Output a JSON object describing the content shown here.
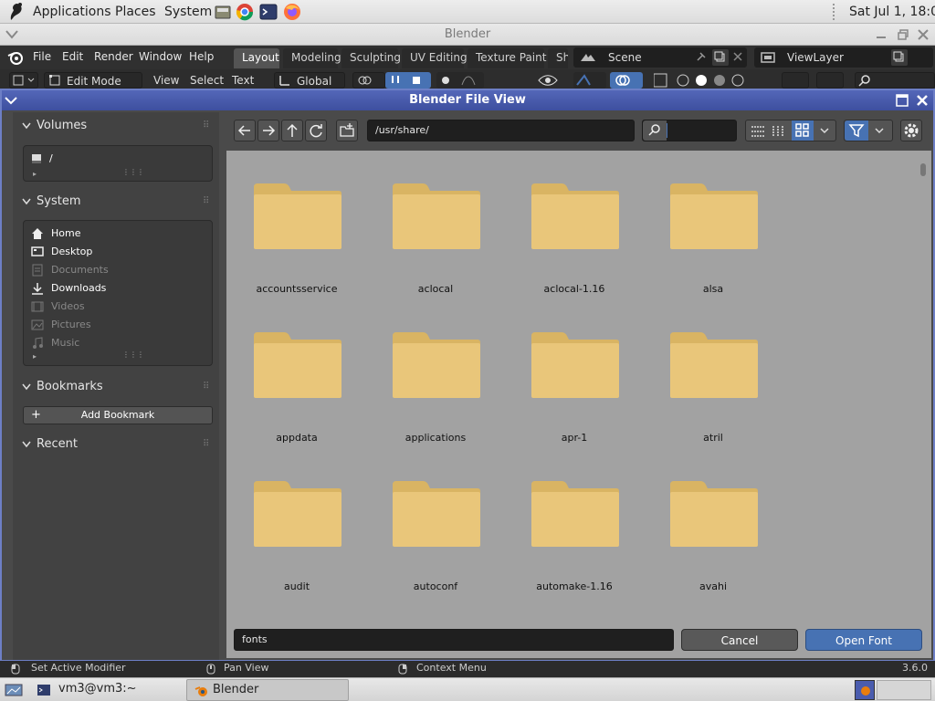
{
  "topbar": {
    "applications": "Applications",
    "places": "Places",
    "system": "System",
    "clock": "Sat Jul 1, 18:05"
  },
  "window": {
    "title": "Blender"
  },
  "blender_header": {
    "menus": [
      "File",
      "Edit",
      "Render",
      "Window",
      "Help"
    ],
    "tabs": [
      "Layout",
      "Modeling",
      "Sculpting",
      "UV Editing",
      "Texture Paint",
      "Sh"
    ],
    "active_tab": "Layout",
    "scene": "Scene",
    "view_layer": "ViewLayer"
  },
  "tool_header": {
    "mode": "Edit Mode",
    "menus": [
      "View",
      "Select",
      "Text"
    ],
    "orientation": "Global"
  },
  "dialog": {
    "title": "Blender File View",
    "path": "/usr/share/",
    "filename": "fonts",
    "cancel": "Cancel",
    "confirm": "Open Font"
  },
  "sidebar": {
    "volumes": {
      "title": "Volumes",
      "items": [
        "/"
      ]
    },
    "system": {
      "title": "System",
      "items": [
        "Home",
        "Desktop",
        "Documents",
        "Downloads",
        "Videos",
        "Pictures",
        "Music"
      ]
    },
    "bookmarks": {
      "title": "Bookmarks",
      "add_label": "Add Bookmark"
    },
    "recent": {
      "title": "Recent"
    }
  },
  "folders": [
    "accountsservice",
    "aclocal",
    "aclocal-1.16",
    "alsa",
    "appdata",
    "applications",
    "apr-1",
    "atril",
    "audit",
    "autoconf",
    "automake-1.16",
    "avahi"
  ],
  "statusbar": {
    "left": "Set Active Modifier",
    "middle": "Pan View",
    "right": "Context Menu",
    "version": "3.6.0"
  },
  "taskbar": {
    "terminal": "vm3@vm3:~",
    "blender": "Blender"
  },
  "colors": {
    "accent": "#4772b3",
    "folder": "#e9c67a",
    "dialog_title": "#4a5cae"
  }
}
